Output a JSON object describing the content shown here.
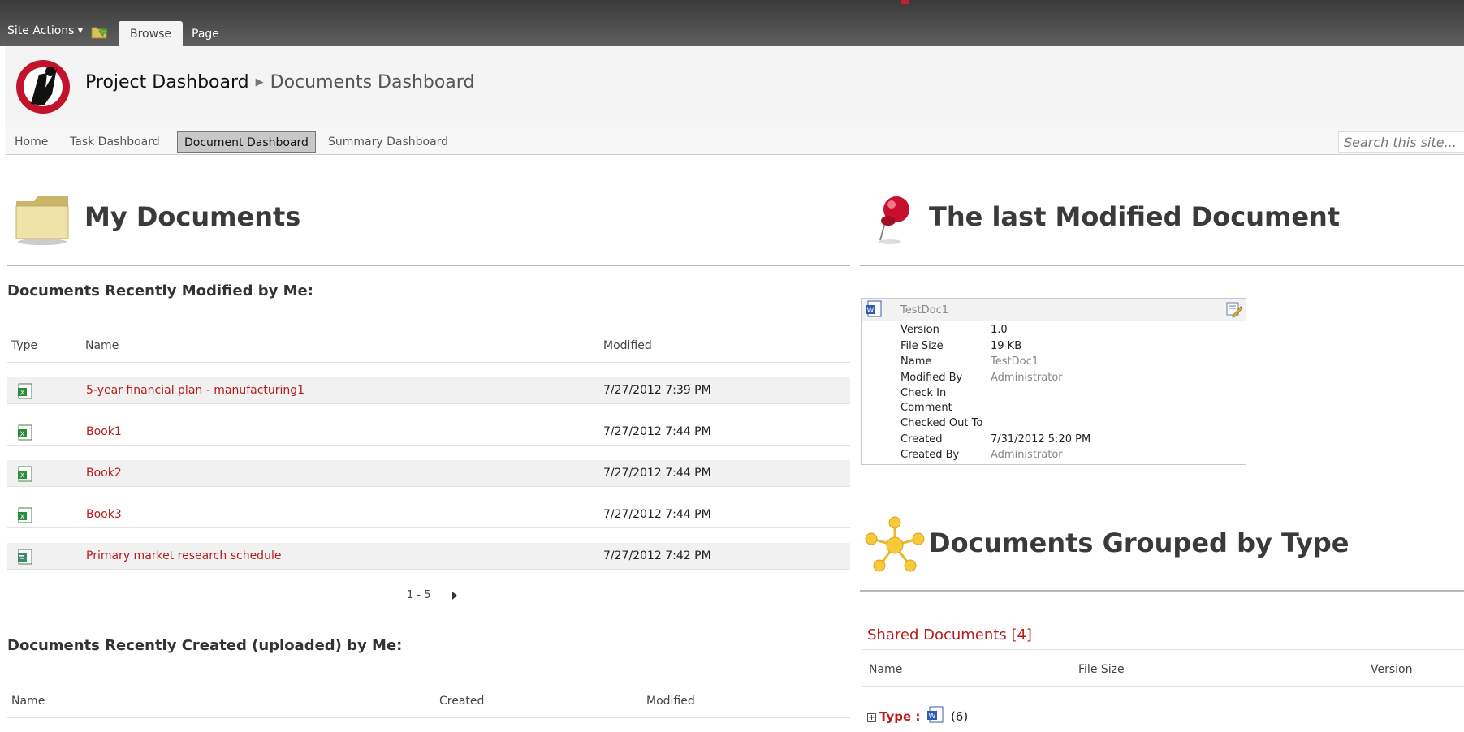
{
  "ribbon": {
    "site_actions": "Site Actions",
    "tabs": [
      {
        "label": "Browse",
        "active": true
      },
      {
        "label": "Page",
        "active": false
      }
    ]
  },
  "header": {
    "breadcrumb_root": "Project Dashboard",
    "breadcrumb_current": "Documents Dashboard"
  },
  "nav": {
    "items": [
      "Home",
      "Task Dashboard",
      "Document Dashboard",
      "Summary Dashboard"
    ],
    "selected_index": 2,
    "search_placeholder": "Search this site..."
  },
  "my_documents": {
    "title": "My Documents",
    "recent_modified": {
      "heading": "Documents Recently Modified by Me:",
      "columns": [
        "Type",
        "Name",
        "Modified"
      ],
      "rows": [
        {
          "name": "5-year financial plan - manufacturing1",
          "modified": "7/27/2012 7:39 PM",
          "icon": "excel-icon"
        },
        {
          "name": "Book1",
          "modified": "7/27/2012 7:44 PM",
          "icon": "excel-icon"
        },
        {
          "name": "Book2",
          "modified": "7/27/2012 7:44 PM",
          "icon": "excel-icon"
        },
        {
          "name": "Book3",
          "modified": "7/27/2012 7:44 PM",
          "icon": "excel-icon"
        },
        {
          "name": "Primary market research schedule",
          "modified": "7/27/2012 7:42 PM",
          "icon": "project-icon"
        }
      ],
      "pager": "1 - 5"
    },
    "recent_created": {
      "heading": "Documents Recently Created (uploaded) by Me:",
      "columns": [
        "Name",
        "Created",
        "Modified"
      ]
    }
  },
  "last_modified": {
    "title": "The last Modified Document",
    "doc_title": "TestDoc1",
    "properties": [
      {
        "label": "Version",
        "value": "1.0",
        "grey": false
      },
      {
        "label": "File Size",
        "value": "19 KB",
        "grey": false
      },
      {
        "label": "Name",
        "value": "TestDoc1",
        "grey": true
      },
      {
        "label": "Modified By",
        "value": "Administrator",
        "grey": true
      },
      {
        "label": "Check In",
        "value": "",
        "grey": false
      },
      {
        "label": "Comment",
        "value": "",
        "grey": false
      },
      {
        "label": "Checked Out To",
        "value": "",
        "grey": false
      },
      {
        "label": "Created",
        "value": "7/31/2012 5:20 PM",
        "grey": false
      },
      {
        "label": "Created By",
        "value": "Administrator",
        "grey": true
      }
    ]
  },
  "grouped": {
    "title": "Documents Grouped by Type",
    "library_link": "Shared Documents [4]",
    "columns": [
      "Name",
      "File Size",
      "Version"
    ],
    "group_label": "Type :",
    "group_count": "(6)"
  },
  "colors": {
    "accent_red": "#b71c1c",
    "ribbon_dark": "#4a4a4a",
    "row_alt": "#f1f1f1"
  }
}
